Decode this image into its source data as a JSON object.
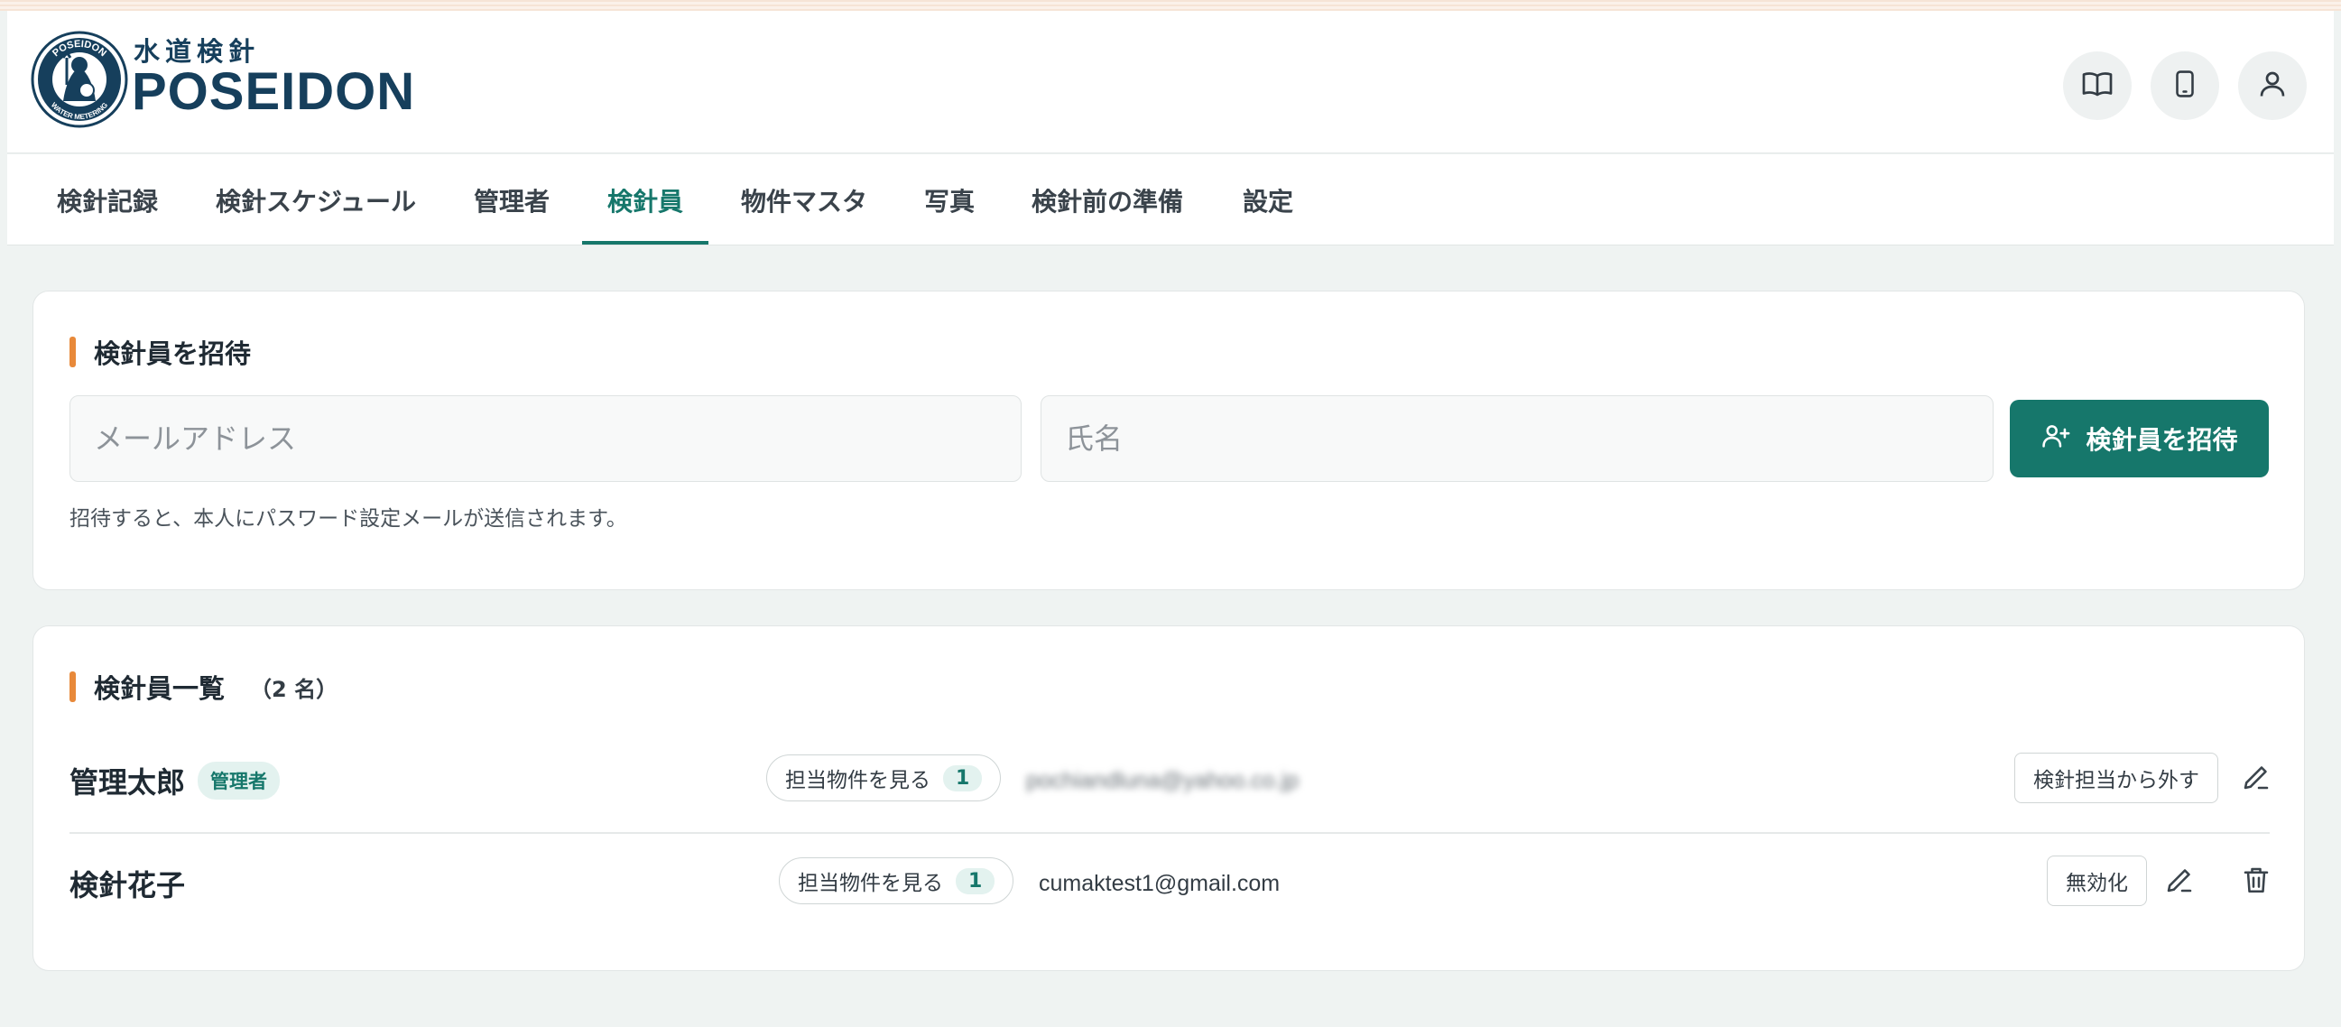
{
  "app": {
    "logo_small_text": "水道検針",
    "logo_big_text": "POSEIDON",
    "badge_top_text": "POSEIDON",
    "badge_bottom_text": "WATER METERING",
    "badge_bottom_small": "READING SYSTEM"
  },
  "header_icons": [
    "book-icon",
    "tablet-icon",
    "user-icon"
  ],
  "nav": {
    "items": [
      {
        "label": "検針記録"
      },
      {
        "label": "検針スケジュール"
      },
      {
        "label": "管理者"
      },
      {
        "label": "検針員"
      },
      {
        "label": "物件マスタ"
      },
      {
        "label": "写真"
      },
      {
        "label": "検針前の準備"
      },
      {
        "label": "設定"
      }
    ],
    "active": "検針員"
  },
  "invite": {
    "title": "検針員を招待",
    "email_placeholder": "メールアドレス",
    "name_placeholder": "氏名",
    "button_label": "検針員を招待",
    "help_text": "招待すると、本人にパスワード設定メールが送信されます。"
  },
  "list": {
    "title": "検針員一覧",
    "count_text": "（2 名）",
    "rows": [
      {
        "name": "管理太郎",
        "badge": "管理者",
        "props_label": "担当物件を見る",
        "props_count": "1",
        "email": "pochiandluna@yahoo.co.jp",
        "action_label": "検針担当から外す"
      },
      {
        "name": "検針花子",
        "badge": "",
        "props_label": "担当物件を見る",
        "props_count": "1",
        "email": "cumaktest1@gmail.com",
        "action_label": "無効化"
      }
    ]
  },
  "colors": {
    "brand": "#16776b",
    "accent": "#e8893a",
    "logo_navy": "#163f5c",
    "background": "#eff3f2"
  }
}
